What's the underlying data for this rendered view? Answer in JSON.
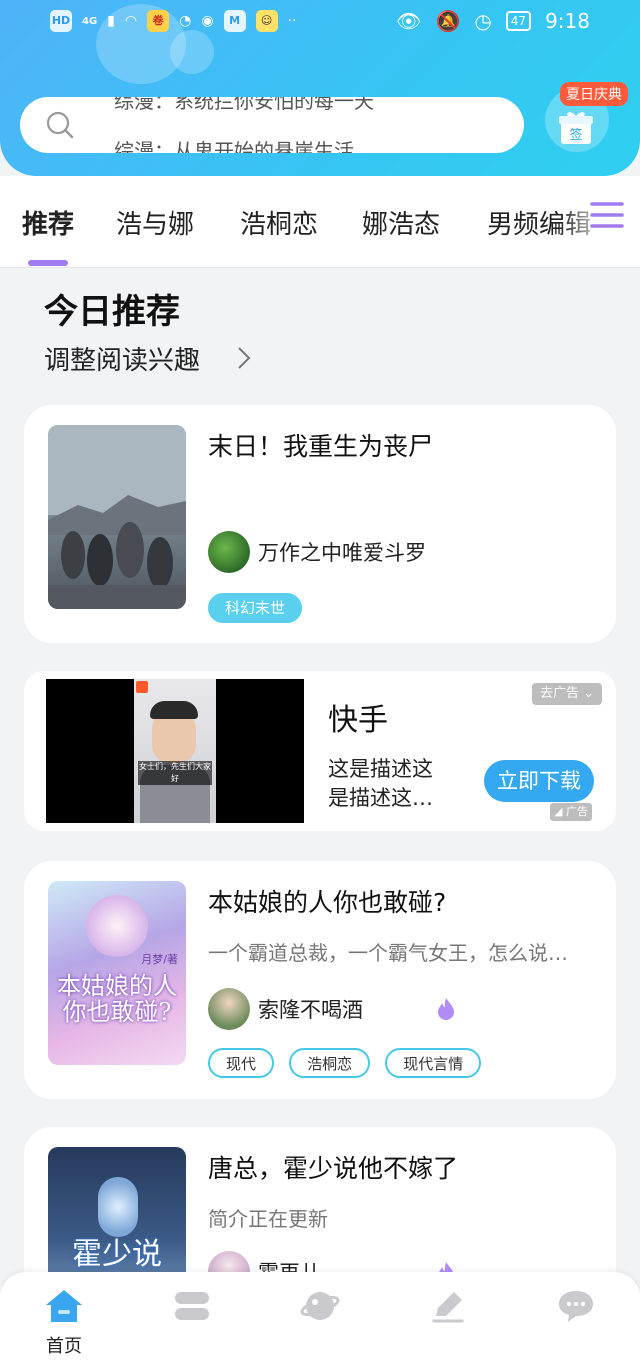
{
  "status_bar": {
    "left_badges": [
      "HD",
      "4G"
    ],
    "battery": "47",
    "time": "9:18"
  },
  "search": {
    "line1": "综漫：系统拦你安怕的每一天",
    "line2": "综漫：从鬼开始的悬崖生活"
  },
  "checkin": {
    "badge": "夏日庆典",
    "label": "签"
  },
  "tabs": [
    "推荐",
    "浩与娜",
    "浩桐恋",
    "娜浩态",
    "男频编辑"
  ],
  "section": {
    "title": "今日推荐",
    "subtitle": "调整阅读兴趣"
  },
  "books": [
    {
      "title": "末日！我重生为丧尸",
      "author": "万作之中唯爱斗罗",
      "tags": [
        "科幻末世"
      ]
    },
    {
      "title": "本姑娘的人你也敢碰?",
      "desc": "一个霸道总裁，一个霸气女王，怎么说…",
      "author": "索隆不喝酒",
      "tags": [
        "现代",
        "浩桐恋",
        "现代言情"
      ],
      "cover_text": "本姑娘的人你也敢碰?",
      "cover_author": "月梦/著"
    },
    {
      "title": "唐总，霍少说他不嫁了",
      "desc": "简介正在更新",
      "author": "霍再儿",
      "cover_text": "霍少说"
    }
  ],
  "ad": {
    "brand": "快手",
    "desc_line1": "这是描述这",
    "desc_line2": "是描述这…",
    "cta": "立即下载",
    "close_label": "去广告",
    "ad_mark": "广告",
    "video_caption": "女士们，先生们大家好"
  },
  "bottom_nav": [
    {
      "label": "首页",
      "icon": "home-icon"
    },
    {
      "label": "",
      "icon": "stack-icon"
    },
    {
      "label": "",
      "icon": "planet-icon"
    },
    {
      "label": "",
      "icon": "pen-icon"
    },
    {
      "label": "",
      "icon": "chat-icon"
    }
  ],
  "colors": {
    "header": "#3fbcf5",
    "accent_purple": "#a07cf0",
    "tag_cyan": "#43c9e8",
    "cta_blue": "#34a8f0"
  }
}
